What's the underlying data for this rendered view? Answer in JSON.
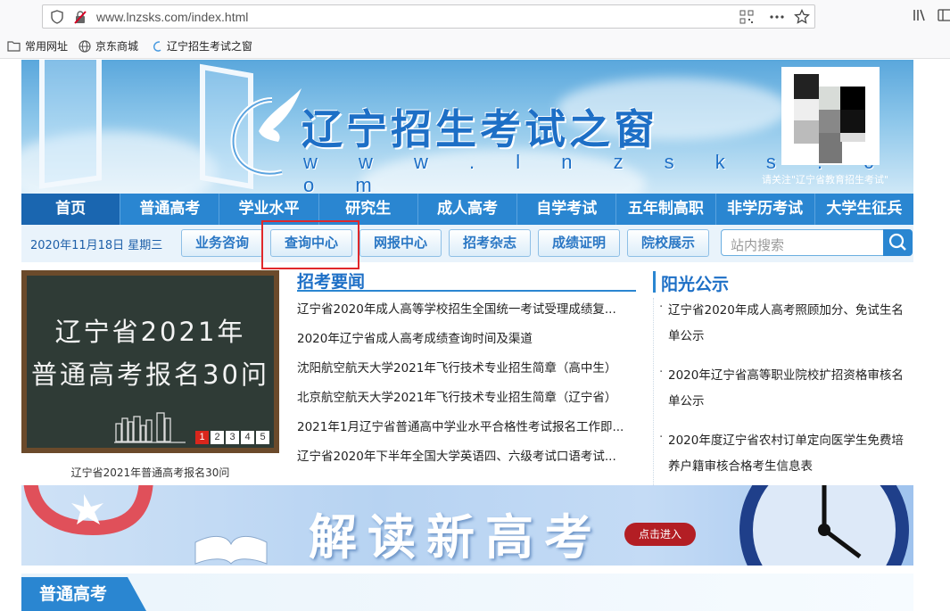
{
  "browser": {
    "url": "www.lnzsks.com/index.html",
    "bookmarks": [
      {
        "label": "常用网址",
        "icon": "folder-icon"
      },
      {
        "label": "京东商城",
        "icon": "globe-icon"
      },
      {
        "label": "辽宁招生考试之窗",
        "icon": "site-icon"
      }
    ]
  },
  "header": {
    "title": "辽宁招生考试之窗",
    "url_text": "w w w . l n z s k s . c o m",
    "qr_caption": "请关注\"辽宁省教育招生考试\""
  },
  "nav": {
    "items": [
      "首页",
      "普通高考",
      "学业水平",
      "研究生",
      "成人高考",
      "自学考试",
      "五年制高职",
      "非学历考试",
      "大学生征兵"
    ]
  },
  "subnav": {
    "date": "2020年11月18日 星期三",
    "buttons": [
      "业务咨询",
      "查询中心",
      "网报中心",
      "招考杂志",
      "成绩证明",
      "院校展示"
    ],
    "search_placeholder": "站内搜索"
  },
  "slideshow": {
    "line1": "辽宁省2021年",
    "line2": "普通高考报名30问",
    "pages": [
      "1",
      "2",
      "3",
      "4",
      "5"
    ],
    "active_page": 1,
    "caption": "辽宁省2021年普通高考报名30问"
  },
  "news": {
    "title": "招考要闻",
    "items": [
      "辽宁省2020年成人高等学校招生全国统一考试受理成绩复...",
      "2020年辽宁省成人高考成绩查询时间及渠道",
      "沈阳航空航天大学2021年飞行技术专业招生简章（高中生）",
      "北京航空航天大学2021年飞行技术专业招生简章（辽宁省）",
      "2021年1月辽宁省普通高中学业水平合格性考试报名工作即...",
      "辽宁省2020年下半年全国大学英语四、六级考试口语考试..."
    ]
  },
  "sunshine": {
    "title": "阳光公示",
    "items": [
      "辽宁省2020年成人高考照顾加分、免试生名单公示",
      "2020年辽宁省高等职业院校扩招资格审核名单公示",
      "2020年度辽宁省农村订单定向医学生免费培养户籍审核合格考生信息表"
    ]
  },
  "promo": {
    "text": "解读新高考",
    "button": "点击进入"
  },
  "section": {
    "title": "普通高考"
  }
}
